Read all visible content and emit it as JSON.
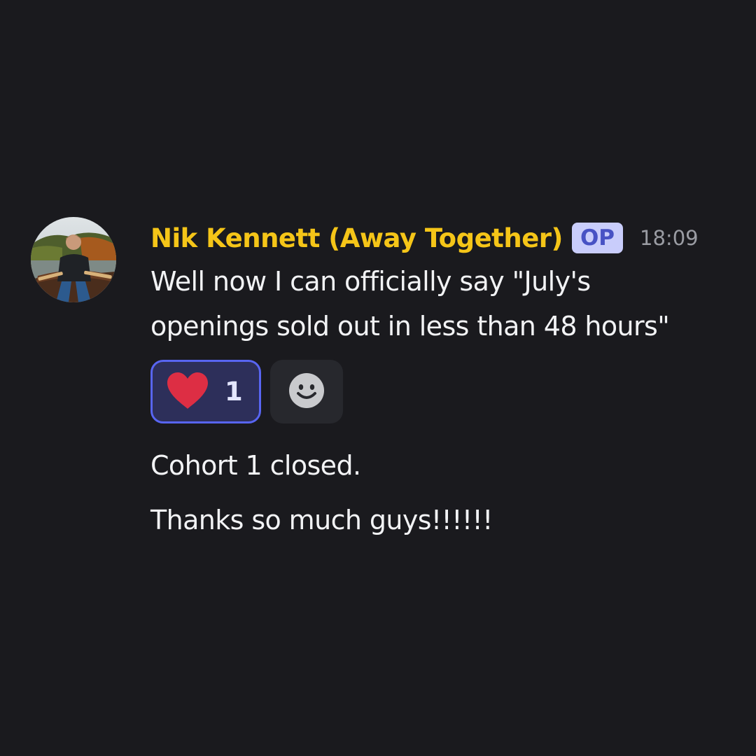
{
  "message": {
    "author": {
      "name": "Nik Kennett (Away Together)",
      "name_color": "#f5c518",
      "badge": "OP",
      "badge_bg": "#c9cdfb",
      "badge_fg": "#4752c4"
    },
    "timestamp": "18:09",
    "lines": [
      "Well now I can officially say \"July's",
      "openings sold out in less than 48 hours\"",
      "Cohort 1 closed.",
      "Thanks so much guys!!!!!!"
    ],
    "reactions": [
      {
        "emoji": "heart-emoji",
        "count": "1",
        "active": true
      }
    ],
    "add_reaction_icon": "smiley-icon"
  }
}
